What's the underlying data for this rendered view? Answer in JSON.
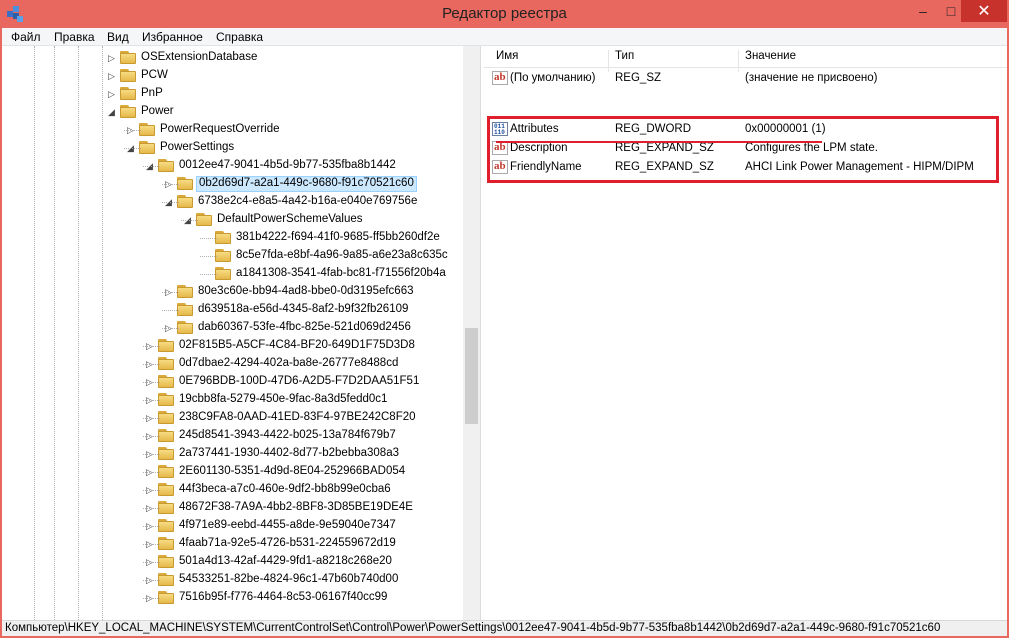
{
  "window": {
    "title": "Редактор реестра",
    "minimize_glyph": "–",
    "maximize_glyph": "□",
    "close_glyph": "✕"
  },
  "menu": [
    "Файл",
    "Правка",
    "Вид",
    "Избранное",
    "Справка"
  ],
  "tree": [
    {
      "label": "OSExtensionDatabase",
      "level": 0,
      "arrow": "collapsed"
    },
    {
      "label": "PCW",
      "level": 0,
      "arrow": "collapsed"
    },
    {
      "label": "PnP",
      "level": 0,
      "arrow": "collapsed"
    },
    {
      "label": "Power",
      "level": 0,
      "arrow": "expanded"
    },
    {
      "label": "PowerRequestOverride",
      "level": 1,
      "arrow": "collapsed"
    },
    {
      "label": "PowerSettings",
      "level": 1,
      "arrow": "expanded"
    },
    {
      "label": "0012ee47-9041-4b5d-9b77-535fba8b1442",
      "level": 2,
      "arrow": "expanded"
    },
    {
      "label": "0b2d69d7-a2a1-449c-9680-f91c70521c60",
      "level": 3,
      "arrow": "collapsed",
      "selected": true
    },
    {
      "label": "6738e2c4-e8a5-4a42-b16a-e040e769756e",
      "level": 3,
      "arrow": "expanded"
    },
    {
      "label": "DefaultPowerSchemeValues",
      "level": 4,
      "arrow": "expanded"
    },
    {
      "label": "381b4222-f694-41f0-9685-ff5bb260df2e",
      "level": 5,
      "arrow": "none"
    },
    {
      "label": "8c5e7fda-e8bf-4a96-9a85-a6e23a8c635c",
      "level": 5,
      "arrow": "none"
    },
    {
      "label": "a1841308-3541-4fab-bc81-f71556f20b4a",
      "level": 5,
      "arrow": "none"
    },
    {
      "label": "80e3c60e-bb94-4ad8-bbe0-0d3195efc663",
      "level": 3,
      "arrow": "collapsed"
    },
    {
      "label": "d639518a-e56d-4345-8af2-b9f32fb26109",
      "level": 3,
      "arrow": "none"
    },
    {
      "label": "dab60367-53fe-4fbc-825e-521d069d2456",
      "level": 3,
      "arrow": "collapsed"
    },
    {
      "label": "02F815B5-A5CF-4C84-BF20-649D1F75D3D8",
      "level": 2,
      "arrow": "collapsed"
    },
    {
      "label": "0d7dbae2-4294-402a-ba8e-26777e8488cd",
      "level": 2,
      "arrow": "collapsed"
    },
    {
      "label": "0E796BDB-100D-47D6-A2D5-F7D2DAA51F51",
      "level": 2,
      "arrow": "collapsed"
    },
    {
      "label": "19cbb8fa-5279-450e-9fac-8a3d5fedd0c1",
      "level": 2,
      "arrow": "collapsed"
    },
    {
      "label": "238C9FA8-0AAD-41ED-83F4-97BE242C8F20",
      "level": 2,
      "arrow": "collapsed"
    },
    {
      "label": "245d8541-3943-4422-b025-13a784f679b7",
      "level": 2,
      "arrow": "collapsed"
    },
    {
      "label": "2a737441-1930-4402-8d77-b2bebba308a3",
      "level": 2,
      "arrow": "collapsed"
    },
    {
      "label": "2E601130-5351-4d9d-8E04-252966BAD054",
      "level": 2,
      "arrow": "collapsed"
    },
    {
      "label": "44f3beca-a7c0-460e-9df2-bb8b99e0cba6",
      "level": 2,
      "arrow": "collapsed"
    },
    {
      "label": "48672F38-7A9A-4bb2-8BF8-3D85BE19DE4E",
      "level": 2,
      "arrow": "collapsed"
    },
    {
      "label": "4f971e89-eebd-4455-a8de-9e59040e7347",
      "level": 2,
      "arrow": "collapsed"
    },
    {
      "label": "4faab71a-92e5-4726-b531-224559672d19",
      "level": 2,
      "arrow": "collapsed"
    },
    {
      "label": "501a4d13-42af-4429-9fd1-a8218c268e20",
      "level": 2,
      "arrow": "collapsed"
    },
    {
      "label": "54533251-82be-4824-96c1-47b60b740d00",
      "level": 2,
      "arrow": "collapsed"
    },
    {
      "label": "7516b95f-f776-4464-8c53-06167f40cc99",
      "level": 2,
      "arrow": "collapsed"
    }
  ],
  "values_header": {
    "name": "Имя",
    "type": "Тип",
    "data": "Значение"
  },
  "values": [
    {
      "name": "(По умолчанию)",
      "type": "REG_SZ",
      "data": "(значение не присвоено)",
      "icon": "string-value-icon"
    },
    {
      "name": "Attributes",
      "type": "REG_DWORD",
      "data": "0x00000001 (1)",
      "icon": "dword-value-icon"
    },
    {
      "name": "Description",
      "type": "REG_EXPAND_SZ",
      "data": "Configures the LPM state.",
      "icon": "string-value-icon"
    },
    {
      "name": "FriendlyName",
      "type": "REG_EXPAND_SZ",
      "data": "AHCI Link Power Management - HIPM/DIPM",
      "icon": "string-value-icon"
    }
  ],
  "status_path": "Компьютер\\HKEY_LOCAL_MACHINE\\SYSTEM\\CurrentControlSet\\Control\\Power\\PowerSettings\\0012ee47-9041-4b5d-9b77-535fba8b1442\\0b2d69d7-a2a1-449c-9680-f91c70521c60",
  "colors": {
    "titlebar": "#e8685f",
    "close_button": "#c7322c",
    "highlight_box": "#e11e2b",
    "selection": "#cce8ff"
  }
}
